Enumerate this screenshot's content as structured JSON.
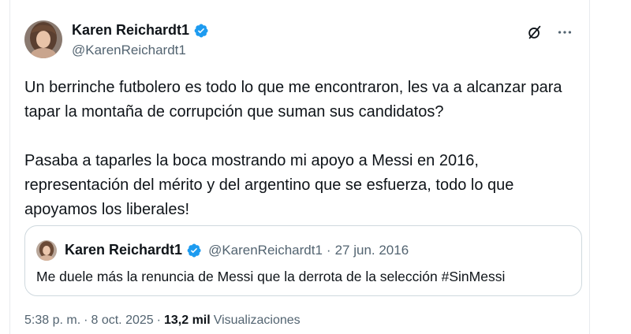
{
  "author": {
    "name": "Karen Reichardt1",
    "handle": "@KarenReichardt1",
    "verified_color": "#1d9bf0"
  },
  "icons": {
    "top_actions": [
      "grok-icon",
      "more-options-icon"
    ]
  },
  "tweet": {
    "paragraph_1": "Un berrinche futbolero es todo lo que me encontraron,  les va a alcanzar para tapar la montaña de corrupción que suman sus candidatos?",
    "paragraph_2": "Pasaba a taparles la boca mostrando mi apoyo a Messi en 2016, representación del mérito y del argentino que se esfuerza, todo lo que apoyamos los liberales!"
  },
  "quote": {
    "name": "Karen Reichardt1",
    "handle": "@KarenReichardt1",
    "separator": "·",
    "date": "27 jun. 2016",
    "text": "Me duele más la renuncia de Messi que la derrota de la selección #SinMessi"
  },
  "meta": {
    "time": "5:38 p. m.",
    "separator": "·",
    "date": "8 oct. 2025",
    "views_count": "13,2 mil",
    "views_label": "Visualizaciones"
  }
}
